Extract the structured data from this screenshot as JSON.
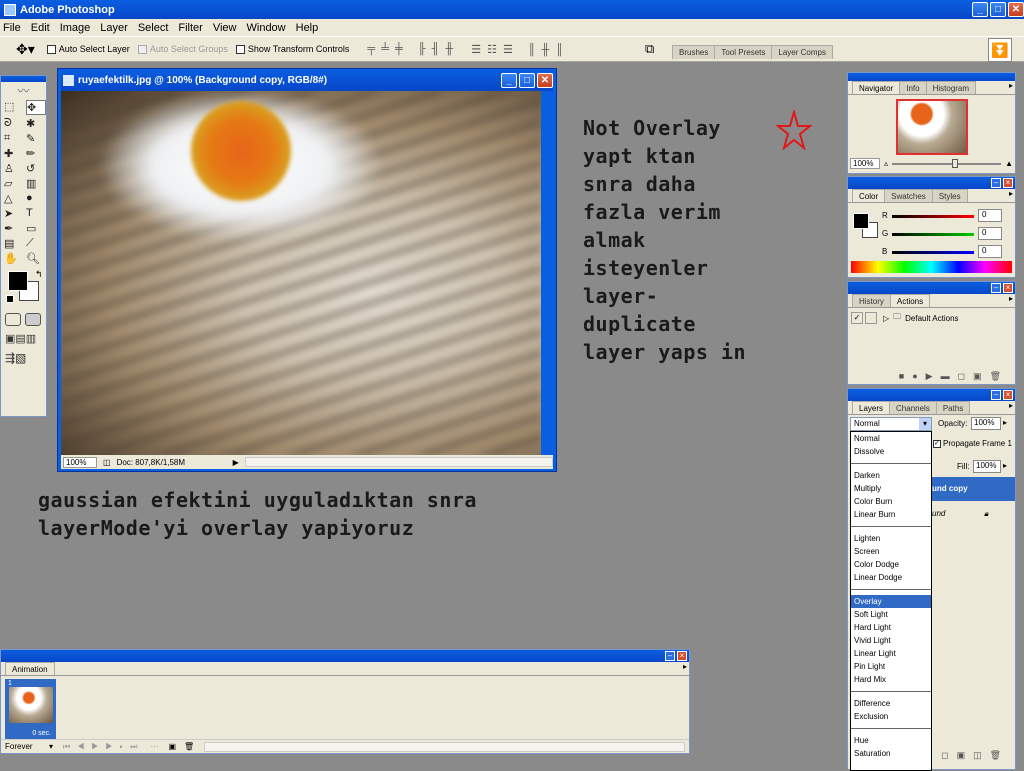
{
  "app": {
    "title": "Adobe Photoshop"
  },
  "menu": [
    "File",
    "Edit",
    "Image",
    "Layer",
    "Select",
    "Filter",
    "View",
    "Window",
    "Help"
  ],
  "options": {
    "auto_select_layer": "Auto Select Layer",
    "auto_select_groups": "Auto Select Groups",
    "show_transform_controls": "Show Transform Controls"
  },
  "wells": [
    "Brushes",
    "Tool Presets",
    "Layer Comps"
  ],
  "doc": {
    "title": "ruyaefektilk.jpg @ 100% (Background copy, RGB/8#)",
    "zoom": "100%",
    "info": "Doc: 807,8K/1,58M"
  },
  "annotation_right": [
    "Not Overlay",
    "yapt ktan",
    "snra daha",
    "fazla verim",
    "almak",
    "isteyenler",
    "layer-",
    "duplicate",
    "layer yaps in"
  ],
  "annotation_bottom": [
    "gaussian efektini uyguladıktan snra",
    "layerMode'yi overlay yapiyoruz"
  ],
  "navigator": {
    "tabs": [
      "Navigator",
      "Info",
      "Histogram"
    ],
    "zoom": "100%"
  },
  "color": {
    "tabs": [
      "Color",
      "Swatches",
      "Styles"
    ],
    "r_label": "R",
    "g_label": "G",
    "b_label": "B",
    "r": "0",
    "g": "0",
    "b": "0"
  },
  "history": {
    "tabs": [
      "History",
      "Actions"
    ],
    "item": "Default Actions"
  },
  "layers": {
    "tabs": [
      "Layers",
      "Channels",
      "Paths"
    ],
    "mode": "Normal",
    "opacity_label": "Opacity:",
    "opacity": "100%",
    "propagate": "Propagate Frame 1",
    "fill_label": "Fill:",
    "fill": "100%",
    "layer_copy": "und copy",
    "layer_bg": "und",
    "blend_groups": [
      [
        "Normal",
        "Dissolve"
      ],
      [
        "Darken",
        "Multiply",
        "Color Burn",
        "Linear Burn"
      ],
      [
        "Lighten",
        "Screen",
        "Color Dodge",
        "Linear Dodge"
      ],
      [
        "Overlay",
        "Soft Light",
        "Hard Light",
        "Vivid Light",
        "Linear Light",
        "Pin Light",
        "Hard Mix"
      ],
      [
        "Difference",
        "Exclusion"
      ],
      [
        "Hue",
        "Saturation"
      ]
    ],
    "selected": "Overlay"
  },
  "animation": {
    "tab": "Animation",
    "frame_index": "1",
    "frame_time": "0 sec.",
    "loop": "Forever"
  },
  "colors": {
    "title_blue": "#0a5fe0",
    "panel_bg": "#ece9d8",
    "workspace": "#8a8a8a",
    "select": "#316ac5"
  }
}
